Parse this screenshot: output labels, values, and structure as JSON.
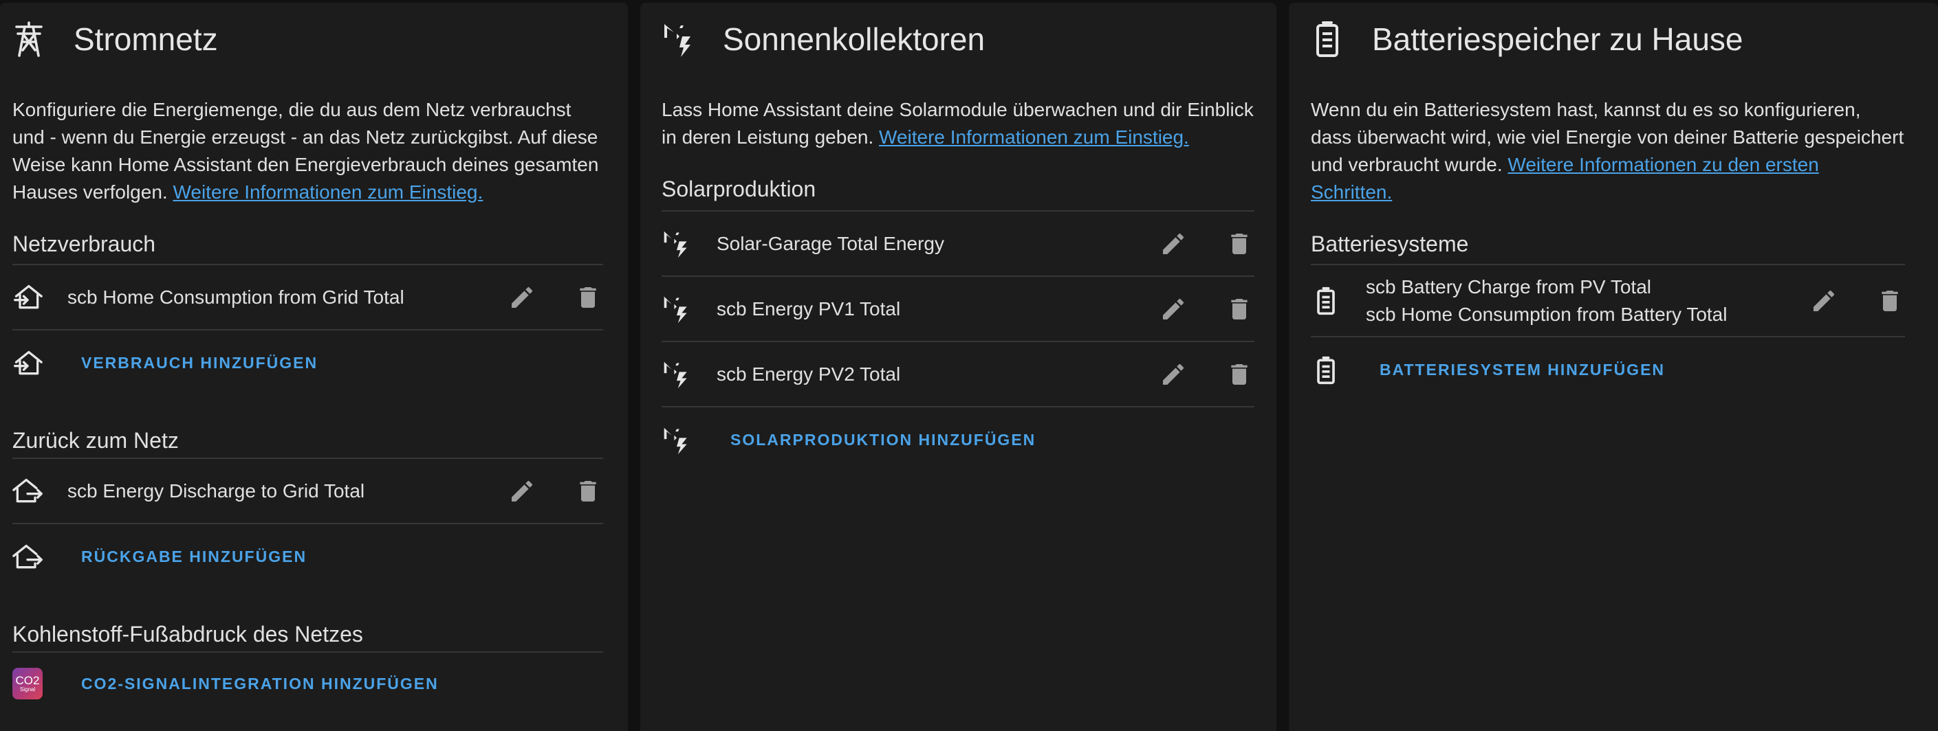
{
  "grid_card": {
    "title": "Stromnetz",
    "icon": "transmission-tower-icon",
    "description": "Konfiguriere die Energiemenge, die du aus dem Netz verbrauchst und - wenn du Energie erzeugst - an das Netz zurückgibst. Auf diese Weise kann Home Assistant den Energieverbrauch deines gesamten Hauses verfolgen.",
    "link": "Weitere Informationen zum Einstieg.",
    "consumption_title": "Netzverbrauch",
    "consumption_items": [
      "scb Home Consumption from Grid Total"
    ],
    "consumption_add": "VERBRAUCH HINZUFÜGEN",
    "return_title": "Zurück zum Netz",
    "return_items": [
      "scb Energy Discharge to Grid Total"
    ],
    "return_add": "RÜCKGABE HINZUFÜGEN",
    "carbon_title": "Kohlenstoff-Fußabdruck des Netzes",
    "carbon_badge_top": "CO2",
    "carbon_badge_bottom": "Signal",
    "carbon_add": "CO2-SIGNALINTEGRATION HINZUFÜGEN"
  },
  "solar_card": {
    "title": "Sonnenkollektoren",
    "icon": "solar-power-icon",
    "description": "Lass Home Assistant deine Solarmodule überwachen und dir Einblick in deren Leistung geben.",
    "link": "Weitere Informationen zum Einstieg.",
    "production_title": "Solarproduktion",
    "items": [
      "Solar-Garage Total Energy",
      "scb Energy PV1 Total",
      "scb Energy PV2 Total"
    ],
    "add": "SOLARPRODUKTION HINZUFÜGEN"
  },
  "battery_card": {
    "title": "Batteriespeicher zu Hause",
    "icon": "home-battery-icon",
    "description": "Wenn du ein Batteriesystem hast, kannst du es so konfigurieren, dass überwacht wird, wie viel Energie von deiner Batterie gespeichert und verbraucht wurde.",
    "link": "Weitere Informationen zu den ersten Schritten.",
    "systems_title": "Batteriesysteme",
    "system_lines": [
      "scb Battery Charge from PV Total",
      "scb Home Consumption from Battery Total"
    ],
    "add": "BATTERIESYSTEM HINZUFÜGEN"
  },
  "colors": {
    "accent": "#4ba3e8",
    "card": "#1c1c1c",
    "background": "#111111",
    "icon_muted": "#9e9e9e"
  }
}
